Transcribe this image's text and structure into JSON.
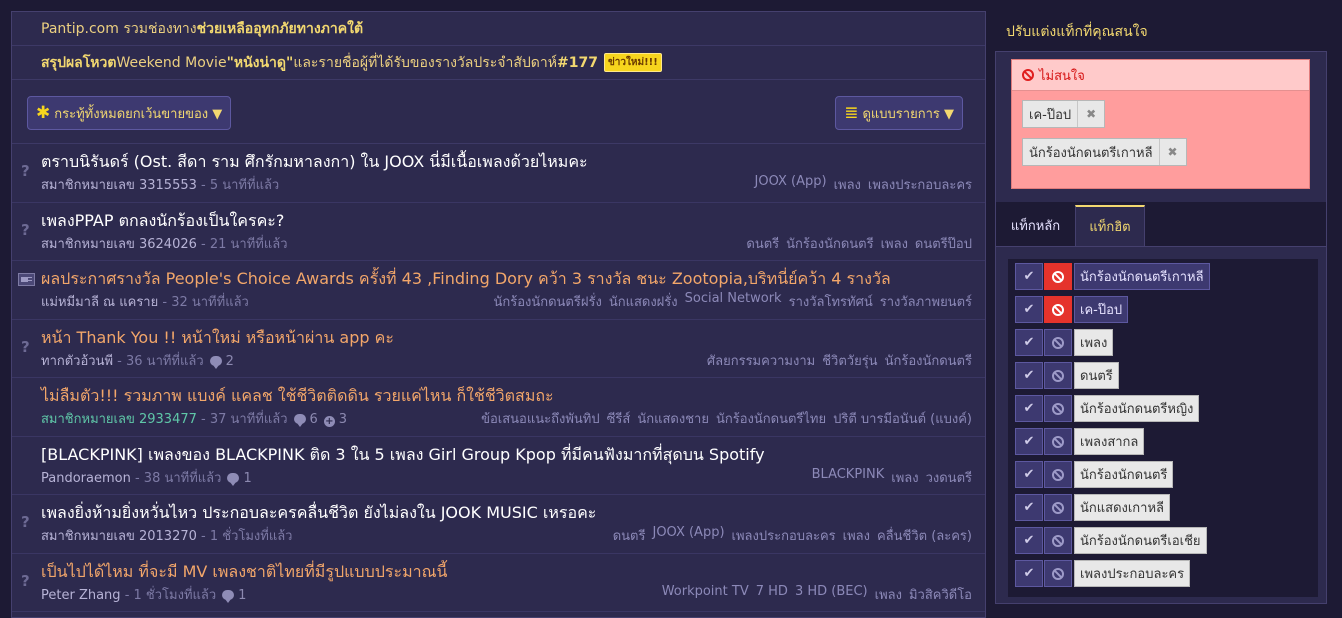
{
  "announcements": [
    {
      "segments": [
        {
          "t": "Pantip.com รวมช่องทาง",
          "c": "y"
        },
        {
          "t": "ช่วยเหลืออุทกภัยทางภาคใต้",
          "c": "b"
        }
      ],
      "badge": ""
    },
    {
      "segments": [
        {
          "t": "สรุปผลโหวต ",
          "c": "b"
        },
        {
          "t": "Weekend Movie ",
          "c": "y"
        },
        {
          "t": "\"หนังน่าดู\"",
          "c": "b"
        },
        {
          "t": " และรายชื่อผู้ที่ได้รับของรางวัลประจำสัปดาห์ ",
          "c": "y"
        },
        {
          "t": "#177",
          "c": "b"
        }
      ],
      "badge": "ข่าวใหม่!!!"
    }
  ],
  "toolbar": {
    "filter_icon": "✱",
    "filter_label": "กระทู้ทั้งหมดยกเว้นขายของ ▼",
    "view_icon": "≣",
    "view_label": "ดูแบบรายการ ▼"
  },
  "topics": [
    {
      "icon": "?",
      "title": "ตราบนิรันดร์ (Ost. สีดา ราม ศึกรักมหาลงกา) ใน JOOX นี่มีเนื้อเพลงด้วยไหมคะ",
      "read": false,
      "author": "สมาชิกหมายเลข 3315553",
      "time": " - 5 นาทีที่แล้ว",
      "comments": "",
      "plus": "",
      "tags": [
        "JOOX (App)",
        "เพลง",
        "เพลงประกอบละคร"
      ]
    },
    {
      "icon": "?",
      "title": "เพลงPPAP ตกลงนักร้องเป็นใครคะ?",
      "read": false,
      "author": "สมาชิกหมายเลข 3624026",
      "time": " - 21 นาทีที่แล้ว",
      "comments": "",
      "plus": "",
      "tags": [
        "ดนตรี",
        "นักร้องนักดนตรี",
        "เพลง",
        "ดนตรีป๊อป"
      ]
    },
    {
      "icon": "news",
      "title": "ผลประกาศรางวัล People's Choice Awards ครั้งที่ 43 ,Finding Dory คว้า 3 รางวัล ชนะ Zootopia,บริทนี่ย์คว้า 4 รางวัล",
      "read": true,
      "author": "แม่หมีมาลี ณ แคราย",
      "time": " - 32 นาทีที่แล้ว",
      "comments": "",
      "plus": "",
      "tags": [
        "นักร้องนักดนตรีฝรั่ง",
        "นักแสดงฝรั่ง",
        "Social Network",
        "รางวัลโทรทัศน์",
        "รางวัลภาพยนตร์"
      ]
    },
    {
      "icon": "?",
      "title": "หน้า Thank You !! หน้าใหม่ หรือหน้าผ่าน app คะ",
      "read": true,
      "author": "ทากตัวอ้วนพี",
      "time": " - 36 นาทีที่แล้ว",
      "comments": "2",
      "plus": "",
      "tags": [
        "ศัลยกรรมความงาม",
        "ชีวิตวัยรุ่น",
        "นักร้องนักดนตรี"
      ]
    },
    {
      "icon": "",
      "title": "ไม่ลืมตัว!!! รวมภาพ แบงค์ แคลช ใช้ชีวิตติดดิน รวยแค่ไหน ก็ใช้ชีวิตสมถะ",
      "read": true,
      "author": "สมาชิกหมายเลข 2933477",
      "time": " - 37 นาทีที่แล้ว",
      "comments": "6",
      "plus": "3",
      "green": true,
      "tags": [
        "ข้อเสนอแนะถึงพันทิป",
        "ซีรีส์",
        "นักแสดงชาย",
        "นักร้องนักดนตรีไทย",
        "ปริตี บารมีอนันต์ (แบงค์)"
      ]
    },
    {
      "icon": "",
      "title": "[BLACKPINK] เพลงของ BLACKPINK ติด 3 ใน 5 เพลง Girl Group Kpop ที่มีคนฟังมากที่สุดบน Spotify",
      "read": false,
      "author": "Pandoraemon",
      "time": " - 38 นาทีที่แล้ว",
      "comments": "1",
      "plus": "",
      "tags": [
        "BLACKPINK",
        "เพลง",
        "วงดนตรี"
      ]
    },
    {
      "icon": "?",
      "title": "เพลงยิ่งห้ามยิ่งหวั่นไหว ประกอบละครคลื่นชีวิต ยังไม่ลงใน JOOK MUSIC เหรอคะ",
      "read": false,
      "author": "สมาชิกหมายเลข 2013270",
      "time": " - 1 ชั่วโมงที่แล้ว",
      "comments": "",
      "plus": "",
      "tags": [
        "ดนตรี",
        "JOOX (App)",
        "เพลงประกอบละคร",
        "เพลง",
        "คลื่นชีวิต (ละคร)"
      ]
    },
    {
      "icon": "?",
      "title": "เป็นไปได้ไหม ที่จะมี MV เพลงชาติไทยที่มีรูปแบบประมาณนี้",
      "read": true,
      "author": "Peter Zhang",
      "time": " - 1 ชั่วโมงที่แล้ว",
      "comments": "1",
      "plus": "",
      "tags": [
        "Workpoint TV",
        "7 HD",
        "3 HD (BEC)",
        "เพลง",
        "มิวสิควิดีโอ"
      ]
    }
  ],
  "sidebar": {
    "title": "ปรับแต่งแท็กที่คุณสนใจ",
    "ignore_title": "ไม่สนใจ",
    "ignored": [
      "เค-ป๊อป",
      "นักร้องนักดนตรีเกาหลี"
    ],
    "remove_glyph": "✖",
    "tab_main": "แท็กหลัก",
    "tab_hot": "แท็กฮิต",
    "check_glyph": "✔",
    "hot_tags": [
      {
        "label": "นักร้องนักดนตรีเกาหลี",
        "ignored": true
      },
      {
        "label": "เค-ป๊อป",
        "ignored": true
      },
      {
        "label": "เพลง",
        "ignored": false
      },
      {
        "label": "ดนตรี",
        "ignored": false
      },
      {
        "label": "นักร้องนักดนตรีหญิง",
        "ignored": false
      },
      {
        "label": "เพลงสากล",
        "ignored": false
      },
      {
        "label": "นักร้องนักดนตรี",
        "ignored": false
      },
      {
        "label": "นักแสดงเกาหลี",
        "ignored": false
      },
      {
        "label": "นักร้องนักดนตรีเอเชีย",
        "ignored": false
      },
      {
        "label": "เพลงประกอบละคร",
        "ignored": false
      }
    ]
  }
}
